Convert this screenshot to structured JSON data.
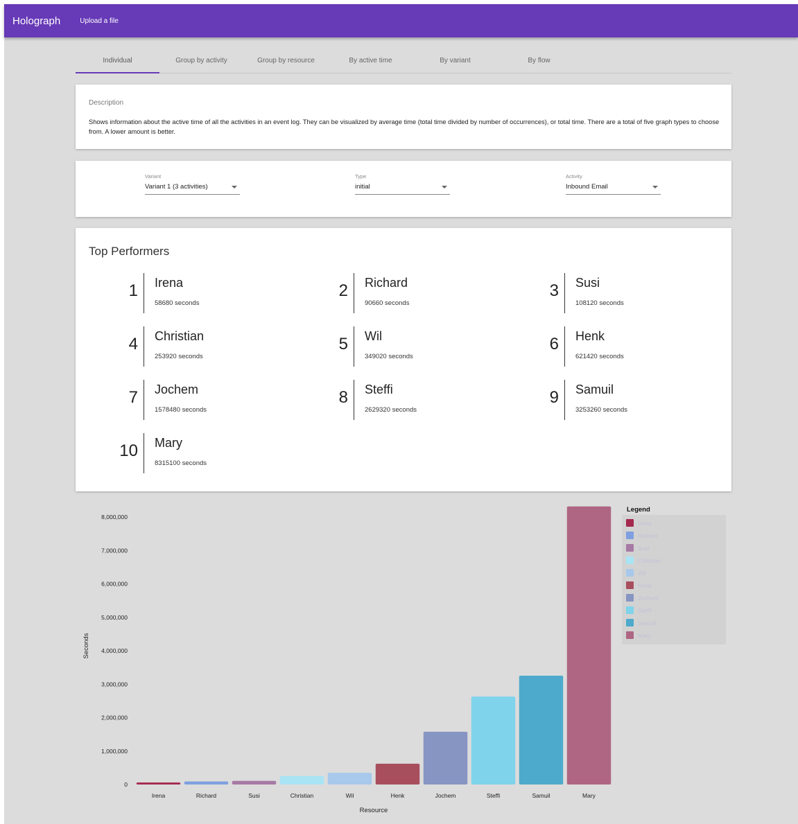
{
  "app": {
    "title": "Holograph",
    "upload_label": "Upload a file"
  },
  "tabs": [
    {
      "label": "Individual",
      "active": true
    },
    {
      "label": "Group by activity",
      "active": false
    },
    {
      "label": "Group by resource",
      "active": false
    },
    {
      "label": "By active time",
      "active": false
    },
    {
      "label": "By variant",
      "active": false
    },
    {
      "label": "By flow",
      "active": false
    }
  ],
  "description": {
    "label": "Description",
    "text": "Shows information about the active time of all the activities in an event log. They can be visualized by average time (total time divided by number of occurrences), or total time. There are a total of five graph types to choose from. A lower amount is better."
  },
  "filters": {
    "variant": {
      "label": "Variant",
      "value": "Variant 1 (3 activities)"
    },
    "type": {
      "label": "Type",
      "value": "initial"
    },
    "activity": {
      "label": "Activity",
      "value": "Inbound Email"
    }
  },
  "top_performers": {
    "title": "Top Performers",
    "items": [
      {
        "rank": "1",
        "name": "Irena",
        "time": "58680 seconds"
      },
      {
        "rank": "2",
        "name": "Richard",
        "time": "90660 seconds"
      },
      {
        "rank": "3",
        "name": "Susi",
        "time": "108120 seconds"
      },
      {
        "rank": "4",
        "name": "Christian",
        "time": "253920 seconds"
      },
      {
        "rank": "5",
        "name": "Wil",
        "time": "349020 seconds"
      },
      {
        "rank": "6",
        "name": "Henk",
        "time": "621420 seconds"
      },
      {
        "rank": "7",
        "name": "Jochem",
        "time": "1578480 seconds"
      },
      {
        "rank": "8",
        "name": "Steffi",
        "time": "2629320 seconds"
      },
      {
        "rank": "9",
        "name": "Samuil",
        "time": "3253260 seconds"
      },
      {
        "rank": "10",
        "name": "Mary",
        "time": "8315100 seconds"
      }
    ]
  },
  "chart_data": {
    "type": "bar",
    "xlabel": "Resource",
    "ylabel": "Seconds",
    "ylim": [
      0,
      8000000
    ],
    "yticks": [
      "0",
      "1,000,000",
      "2,000,000",
      "3,000,000",
      "4,000,000",
      "5,000,000",
      "6,000,000",
      "7,000,000",
      "8,000,000"
    ],
    "categories": [
      "Irena",
      "Richard",
      "Susi",
      "Christian",
      "Wil",
      "Henk",
      "Jochem",
      "Steffi",
      "Samuil",
      "Mary"
    ],
    "values": [
      58680,
      90660,
      108120,
      253920,
      349020,
      621420,
      1578480,
      2629320,
      3253260,
      8315100
    ],
    "colors": [
      "#a5284e",
      "#7f9fe0",
      "#a77aa5",
      "#a9e4f5",
      "#a8c8ec",
      "#a84f5e",
      "#8795c2",
      "#7fd3eb",
      "#4daacc",
      "#ae6683"
    ],
    "legend": {
      "title": "Legend",
      "position": "top-right"
    }
  }
}
